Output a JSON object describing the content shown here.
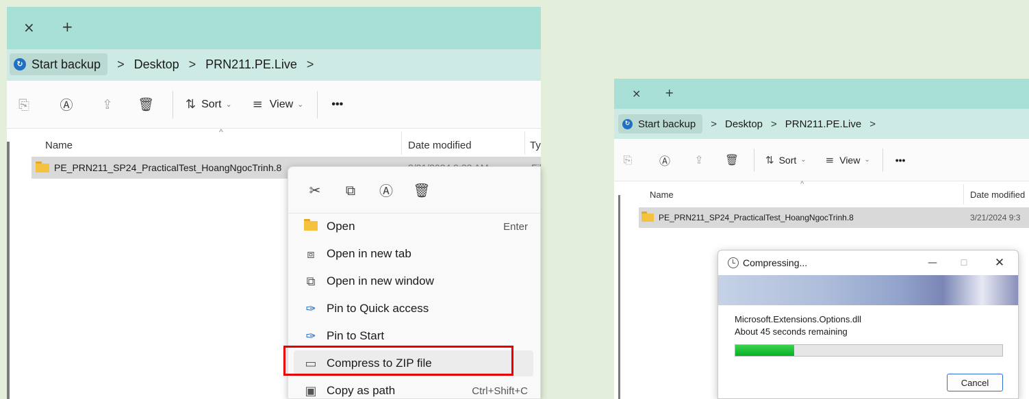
{
  "left_window": {
    "address": {
      "backup_label": "Start backup",
      "path": [
        "Desktop",
        "PRN211.PE.Live"
      ]
    },
    "toolbar": {
      "sort_label": "Sort",
      "view_label": "View",
      "more_label": "•••"
    },
    "columns": {
      "name": "Name",
      "date_modified": "Date modified",
      "type": "Ty"
    },
    "file": {
      "name": "PE_PRN211_SP24_PracticalTest_HoangNgocTrinh.8",
      "date": "3/21/2024 9:33 AM",
      "type": "Fil"
    }
  },
  "context_menu": {
    "items": [
      {
        "icon": "folder-open-icon",
        "label": "Open",
        "shortcut": "Enter"
      },
      {
        "icon": "new-tab-icon",
        "label": "Open in new tab",
        "shortcut": ""
      },
      {
        "icon": "new-window-icon",
        "label": "Open in new window",
        "shortcut": ""
      },
      {
        "icon": "pin-icon",
        "label": "Pin to Quick access",
        "shortcut": ""
      },
      {
        "icon": "pin-icon",
        "label": "Pin to Start",
        "shortcut": ""
      },
      {
        "icon": "zip-icon",
        "label": "Compress to ZIP file",
        "shortcut": ""
      },
      {
        "icon": "copy-path-icon",
        "label": "Copy as path",
        "shortcut": "Ctrl+Shift+C"
      }
    ],
    "highlight_color": "#e60000"
  },
  "right_window": {
    "address": {
      "backup_label": "Start backup",
      "path": [
        "Desktop",
        "PRN211.PE.Live"
      ]
    },
    "toolbar": {
      "sort_label": "Sort",
      "view_label": "View",
      "more_label": "•••"
    },
    "columns": {
      "name": "Name",
      "date_modified": "Date modified"
    },
    "file": {
      "name": "PE_PRN211_SP24_PracticalTest_HoangNgocTrinh.8",
      "date": "3/21/2024 9:3"
    }
  },
  "dialog": {
    "title": "Compressing...",
    "file": "Microsoft.Extensions.Options.dll",
    "remaining": "About 45 seconds remaining",
    "progress": 0.22,
    "cancel_label": "Cancel",
    "progress_color": "#06b025"
  }
}
